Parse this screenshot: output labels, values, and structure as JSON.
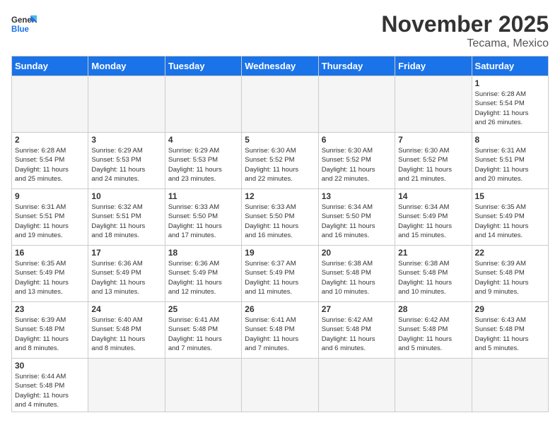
{
  "header": {
    "logo_general": "General",
    "logo_blue": "Blue",
    "month": "November 2025",
    "location": "Tecama, Mexico"
  },
  "days_of_week": [
    "Sunday",
    "Monday",
    "Tuesday",
    "Wednesday",
    "Thursday",
    "Friday",
    "Saturday"
  ],
  "weeks": [
    [
      {
        "day": "",
        "empty": true,
        "content": ""
      },
      {
        "day": "",
        "empty": true,
        "content": ""
      },
      {
        "day": "",
        "empty": true,
        "content": ""
      },
      {
        "day": "",
        "empty": true,
        "content": ""
      },
      {
        "day": "",
        "empty": true,
        "content": ""
      },
      {
        "day": "",
        "empty": true,
        "content": ""
      },
      {
        "day": "1",
        "empty": false,
        "content": "Sunrise: 6:28 AM\nSunset: 5:54 PM\nDaylight: 11 hours\nand 26 minutes."
      }
    ],
    [
      {
        "day": "2",
        "empty": false,
        "content": "Sunrise: 6:28 AM\nSunset: 5:54 PM\nDaylight: 11 hours\nand 25 minutes."
      },
      {
        "day": "3",
        "empty": false,
        "content": "Sunrise: 6:29 AM\nSunset: 5:53 PM\nDaylight: 11 hours\nand 24 minutes."
      },
      {
        "day": "4",
        "empty": false,
        "content": "Sunrise: 6:29 AM\nSunset: 5:53 PM\nDaylight: 11 hours\nand 23 minutes."
      },
      {
        "day": "5",
        "empty": false,
        "content": "Sunrise: 6:30 AM\nSunset: 5:52 PM\nDaylight: 11 hours\nand 22 minutes."
      },
      {
        "day": "6",
        "empty": false,
        "content": "Sunrise: 6:30 AM\nSunset: 5:52 PM\nDaylight: 11 hours\nand 22 minutes."
      },
      {
        "day": "7",
        "empty": false,
        "content": "Sunrise: 6:30 AM\nSunset: 5:52 PM\nDaylight: 11 hours\nand 21 minutes."
      },
      {
        "day": "8",
        "empty": false,
        "content": "Sunrise: 6:31 AM\nSunset: 5:51 PM\nDaylight: 11 hours\nand 20 minutes."
      }
    ],
    [
      {
        "day": "9",
        "empty": false,
        "content": "Sunrise: 6:31 AM\nSunset: 5:51 PM\nDaylight: 11 hours\nand 19 minutes."
      },
      {
        "day": "10",
        "empty": false,
        "content": "Sunrise: 6:32 AM\nSunset: 5:51 PM\nDaylight: 11 hours\nand 18 minutes."
      },
      {
        "day": "11",
        "empty": false,
        "content": "Sunrise: 6:33 AM\nSunset: 5:50 PM\nDaylight: 11 hours\nand 17 minutes."
      },
      {
        "day": "12",
        "empty": false,
        "content": "Sunrise: 6:33 AM\nSunset: 5:50 PM\nDaylight: 11 hours\nand 16 minutes."
      },
      {
        "day": "13",
        "empty": false,
        "content": "Sunrise: 6:34 AM\nSunset: 5:50 PM\nDaylight: 11 hours\nand 16 minutes."
      },
      {
        "day": "14",
        "empty": false,
        "content": "Sunrise: 6:34 AM\nSunset: 5:49 PM\nDaylight: 11 hours\nand 15 minutes."
      },
      {
        "day": "15",
        "empty": false,
        "content": "Sunrise: 6:35 AM\nSunset: 5:49 PM\nDaylight: 11 hours\nand 14 minutes."
      }
    ],
    [
      {
        "day": "16",
        "empty": false,
        "content": "Sunrise: 6:35 AM\nSunset: 5:49 PM\nDaylight: 11 hours\nand 13 minutes."
      },
      {
        "day": "17",
        "empty": false,
        "content": "Sunrise: 6:36 AM\nSunset: 5:49 PM\nDaylight: 11 hours\nand 13 minutes."
      },
      {
        "day": "18",
        "empty": false,
        "content": "Sunrise: 6:36 AM\nSunset: 5:49 PM\nDaylight: 11 hours\nand 12 minutes."
      },
      {
        "day": "19",
        "empty": false,
        "content": "Sunrise: 6:37 AM\nSunset: 5:49 PM\nDaylight: 11 hours\nand 11 minutes."
      },
      {
        "day": "20",
        "empty": false,
        "content": "Sunrise: 6:38 AM\nSunset: 5:48 PM\nDaylight: 11 hours\nand 10 minutes."
      },
      {
        "day": "21",
        "empty": false,
        "content": "Sunrise: 6:38 AM\nSunset: 5:48 PM\nDaylight: 11 hours\nand 10 minutes."
      },
      {
        "day": "22",
        "empty": false,
        "content": "Sunrise: 6:39 AM\nSunset: 5:48 PM\nDaylight: 11 hours\nand 9 minutes."
      }
    ],
    [
      {
        "day": "23",
        "empty": false,
        "content": "Sunrise: 6:39 AM\nSunset: 5:48 PM\nDaylight: 11 hours\nand 8 minutes."
      },
      {
        "day": "24",
        "empty": false,
        "content": "Sunrise: 6:40 AM\nSunset: 5:48 PM\nDaylight: 11 hours\nand 8 minutes."
      },
      {
        "day": "25",
        "empty": false,
        "content": "Sunrise: 6:41 AM\nSunset: 5:48 PM\nDaylight: 11 hours\nand 7 minutes."
      },
      {
        "day": "26",
        "empty": false,
        "content": "Sunrise: 6:41 AM\nSunset: 5:48 PM\nDaylight: 11 hours\nand 7 minutes."
      },
      {
        "day": "27",
        "empty": false,
        "content": "Sunrise: 6:42 AM\nSunset: 5:48 PM\nDaylight: 11 hours\nand 6 minutes."
      },
      {
        "day": "28",
        "empty": false,
        "content": "Sunrise: 6:42 AM\nSunset: 5:48 PM\nDaylight: 11 hours\nand 5 minutes."
      },
      {
        "day": "29",
        "empty": false,
        "content": "Sunrise: 6:43 AM\nSunset: 5:48 PM\nDaylight: 11 hours\nand 5 minutes."
      }
    ],
    [
      {
        "day": "30",
        "empty": false,
        "content": "Sunrise: 6:44 AM\nSunset: 5:48 PM\nDaylight: 11 hours\nand 4 minutes.",
        "last": true
      },
      {
        "day": "",
        "empty": true,
        "last": true,
        "content": ""
      },
      {
        "day": "",
        "empty": true,
        "last": true,
        "content": ""
      },
      {
        "day": "",
        "empty": true,
        "last": true,
        "content": ""
      },
      {
        "day": "",
        "empty": true,
        "last": true,
        "content": ""
      },
      {
        "day": "",
        "empty": true,
        "last": true,
        "content": ""
      },
      {
        "day": "",
        "empty": true,
        "last": true,
        "content": ""
      }
    ]
  ]
}
